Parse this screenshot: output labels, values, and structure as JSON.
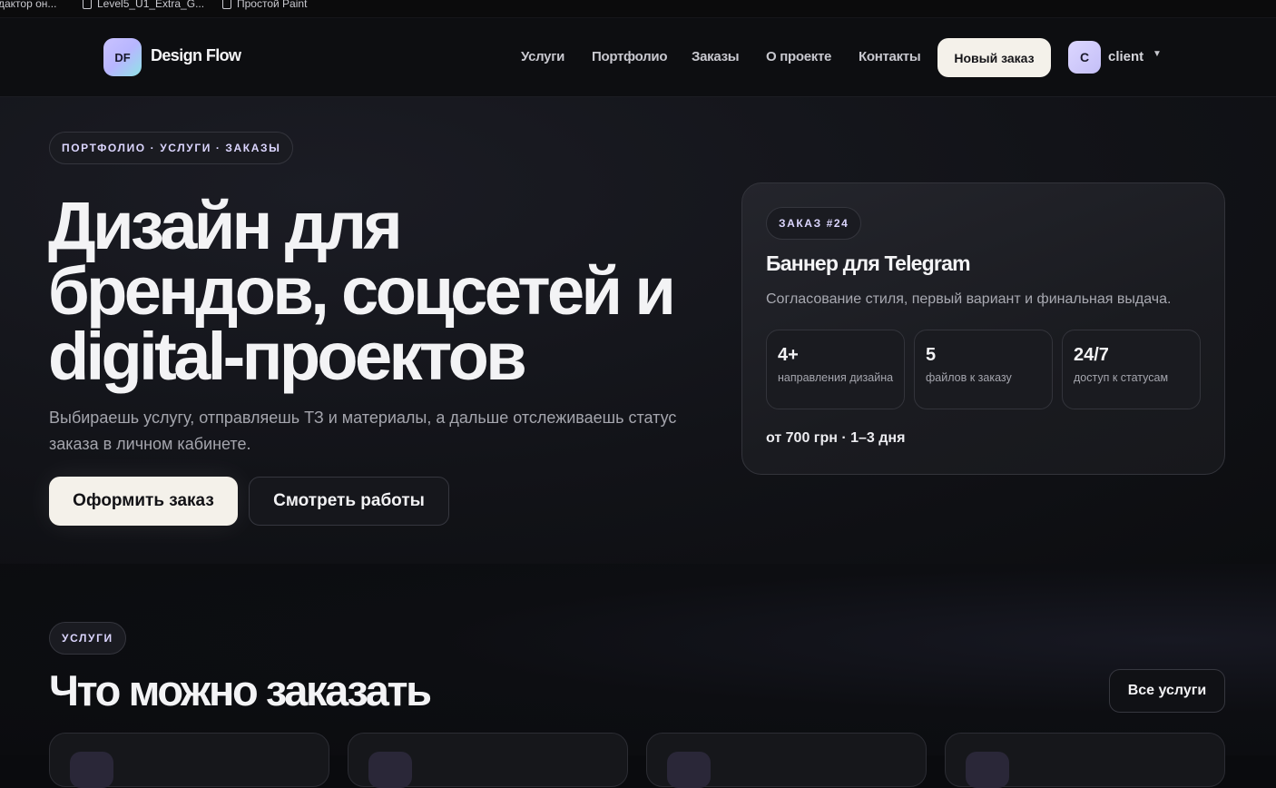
{
  "bookmarks": [
    {
      "label": "дактор он..."
    },
    {
      "label": "Level5_U1_Extra_G..."
    },
    {
      "label": "Простой Paint"
    }
  ],
  "nav": {
    "logo_badge": "DF",
    "logo_text": "Design Flow",
    "links": [
      "Услуги",
      "Портфолио",
      "Заказы",
      "О проекте",
      "Контакты"
    ],
    "new_order": "Новый заказ",
    "avatar_letter": "C",
    "user": "client"
  },
  "hero": {
    "pill": "ПОРТФОЛИО · УСЛУГИ · ЗАКАЗЫ",
    "title_lines": [
      "Дизайн для",
      "брендов, соцсетей и",
      "digital-проектов"
    ],
    "subtitle": "Выбираешь услугу, отправляешь ТЗ и материалы, а дальше отслеживаешь статус заказа в личном кабинете.",
    "primary_button": "Оформить заказ",
    "secondary_button": "Смотреть работы"
  },
  "order_card": {
    "badge": "ЗАКАЗ #24",
    "title": "Баннер для Telegram",
    "description": "Согласование стиля, первый вариант и финальная выдача.",
    "stats": [
      {
        "value": "4+",
        "label": "направления дизайна"
      },
      {
        "value": "5",
        "label": "файлов к заказу"
      },
      {
        "value": "24/7",
        "label": "доступ к статусам"
      }
    ],
    "price": "от 700 грн · 1–3 дня"
  },
  "services": {
    "pill": "УСЛУГИ",
    "title": "Что можно заказать",
    "all_button": "Все услуги"
  }
}
